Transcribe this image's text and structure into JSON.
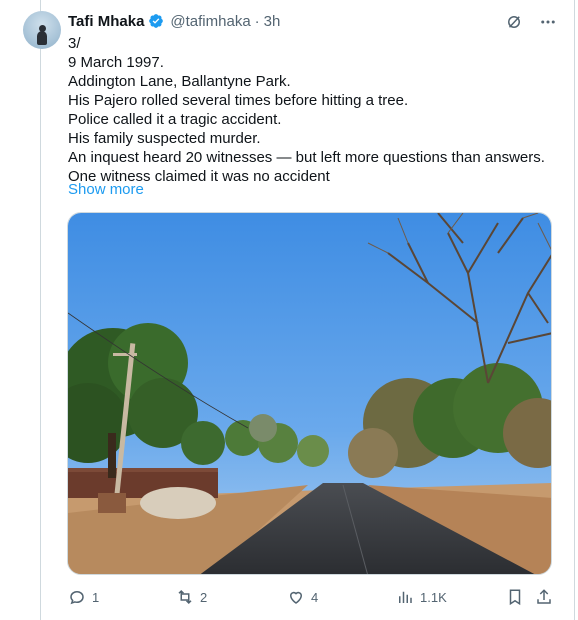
{
  "tweet": {
    "author_name": "Tafi Mhaka",
    "handle": "@tafimhaka",
    "separator": "·",
    "time": "3h",
    "lines": [
      "3/",
      "9 March 1997.",
      "Addington Lane, Ballantyne Park.",
      "His Pajero rolled several times before hitting a tree.",
      "Police called it a tragic accident.",
      "His family suspected murder.",
      "An inquest heard 20 witnesses — but left more questions than answers.",
      "One witness claimed it was no accident"
    ],
    "show_more": "Show more",
    "media": {
      "icon": "photo-road-trees"
    }
  },
  "actions": {
    "replies": "1",
    "reposts": "2",
    "likes": "4",
    "views": "1.1K"
  },
  "icons": {
    "verified": "verified-badge-icon",
    "grok": "grok-icon",
    "more": "more-icon",
    "reply": "reply-icon",
    "repost": "repost-icon",
    "like": "heart-icon",
    "views": "views-icon",
    "bookmark": "bookmark-icon",
    "share": "share-icon"
  },
  "colors": {
    "accent": "#1d9bf0",
    "text": "#0f1419",
    "muted": "#536471",
    "border": "#cfd9de"
  }
}
